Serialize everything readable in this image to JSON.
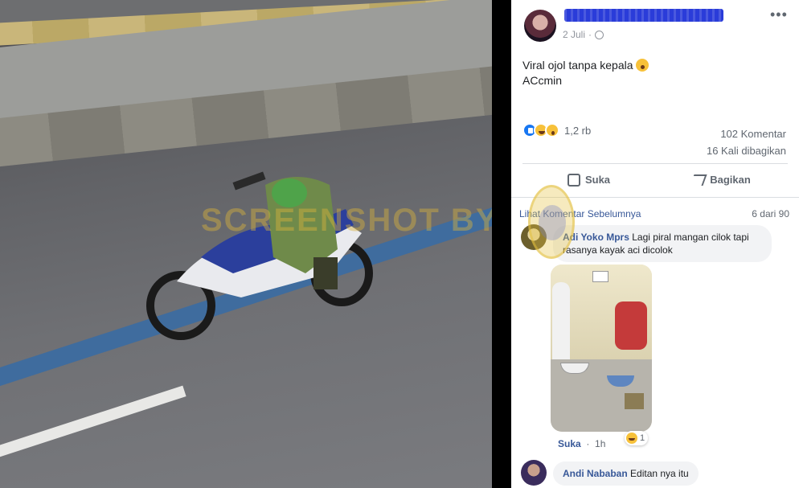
{
  "post": {
    "date": "2 Juli",
    "date_separator": "·",
    "more_label": "•••",
    "text_line1": "Viral ojol tanpa kepala",
    "text_line2": "ACcmin",
    "reaction_count": "1,2 rb",
    "comments_count": "102 Komentar",
    "shares_count": "16 Kali dibagikan",
    "actions": {
      "like": "Suka",
      "share": "Bagikan"
    },
    "icons": [
      "globe-icon",
      "like-reaction-icon",
      "haha-reaction-icon",
      "wow-reaction-icon",
      "thumbs-up-icon",
      "share-arrow-icon"
    ]
  },
  "photo": {
    "watermark": "SCREENSHOT BY"
  },
  "comments_section": {
    "previous_link": "Lihat Komentar Sebelumnya",
    "pagination": "6 dari 90",
    "comments": [
      {
        "author": "Adi Yoko Mprs",
        "text": "Lagi piral mangan cilok tapi rasanya kayak aci dicolok",
        "like_label": "Suka",
        "time": "1h",
        "reaction_count": "1"
      },
      {
        "author": "Andi Nababan",
        "text": "Editan nya itu"
      }
    ]
  },
  "colors": {
    "link_blue": "#385898",
    "accent_blue": "#1877f2",
    "muted_text": "#606770",
    "bubble_bg": "#f2f3f5"
  }
}
